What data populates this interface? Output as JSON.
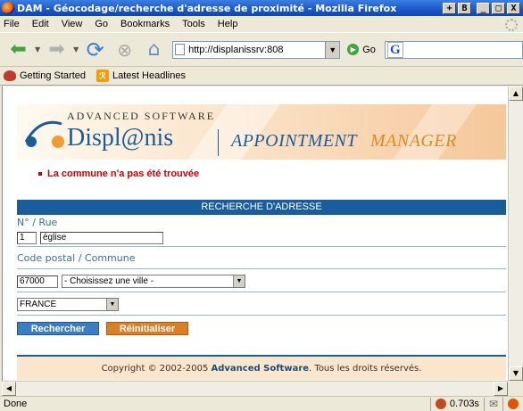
{
  "window": {
    "title": "DAM - Géocodage/recherche d'adresse de proximité - Mozilla Firefox",
    "buttons": [
      "+",
      "B",
      "_",
      "□",
      "X"
    ]
  },
  "menubar": {
    "items": [
      "File",
      "Edit",
      "View",
      "Go",
      "Bookmarks",
      "Tools",
      "Help"
    ]
  },
  "navbar": {
    "url": "http://displanissrv:808",
    "go_label": "Go",
    "search_placeholder": ""
  },
  "bookmarks": {
    "items": [
      "Getting Started",
      "Latest Headlines"
    ]
  },
  "banner": {
    "company": "ADVANCED SOFTWARE",
    "product": "Displ@nis",
    "app_part1": "APPOINTMENT",
    "app_part2": "MANAGER"
  },
  "error_message": "La commune n'a pas été trouvée",
  "form": {
    "header": "RECHERCHE D'ADRESSE",
    "street_label": "N° / Rue",
    "number_value": "1",
    "street_value": "église",
    "city_label": "Code postal / Commune",
    "postal_value": "67000",
    "city_select": "- Choisissez une ville -",
    "country_select": "FRANCE",
    "search_button": "Rechercher",
    "reset_button": "Réinitialiser"
  },
  "footer": {
    "prefix": "Copyright © 2002-2005",
    "company": "Advanced Software",
    "suffix": ". Tous les droits réservés."
  },
  "status": {
    "text": "Done",
    "time": "0.703s"
  },
  "colors": {
    "accent_blue": "#1a5d9c",
    "accent_orange": "#e08a24",
    "error_red": "#cc0000"
  }
}
